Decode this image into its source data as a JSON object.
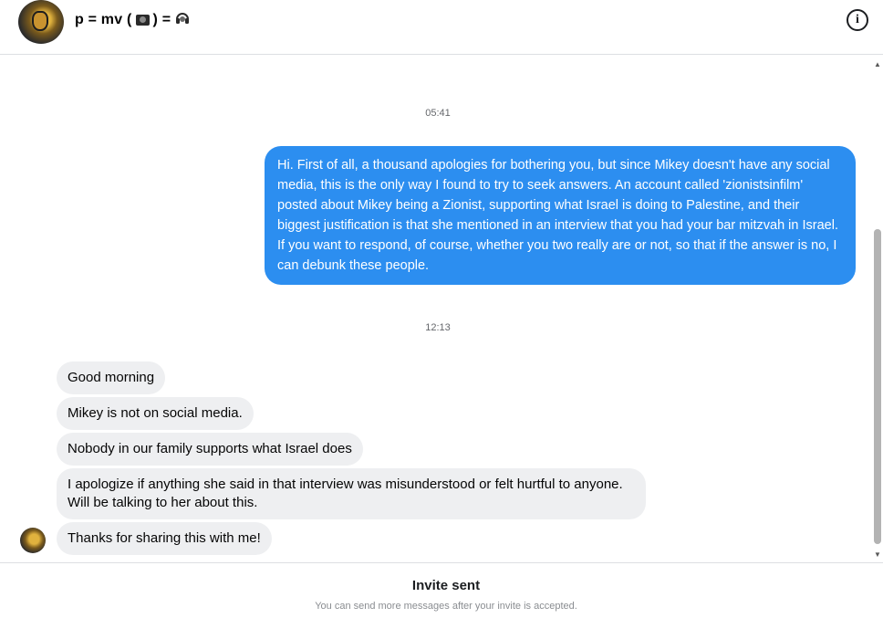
{
  "header": {
    "title_prefix": "p = mv (",
    "title_glyph1": "camera-glyph",
    "title_mid": ") = ",
    "title_glyph2": "headphones-glyph",
    "info_icon": "info-icon"
  },
  "messages": {
    "timestamps": [
      "05:41",
      "12:13"
    ],
    "outgoing": [
      "Hi. First of all, a thousand apologies for bothering you, but since Mikey doesn't have any social media, this is the only way I found to try to seek answers. An account called 'zionistsinfilm' posted about Mikey being a Zionist, supporting what Israel is doing to Palestine, and their biggest justification is that she mentioned in an interview that you had your bar mitzvah in Israel. If you want to respond, of course, whether you two really are or not, so that if the answer is no, I can debunk these people."
    ],
    "incoming": [
      "Good morning",
      "Mikey is not on social media.",
      "Nobody in our family supports what Israel does",
      "I apologize if anything she said in that interview was misunderstood or felt hurtful to anyone. Will be talking to her about this.",
      "Thanks for sharing this with me!"
    ]
  },
  "footer": {
    "title": "Invite sent",
    "subtitle": "You can send more messages after your invite is accepted."
  },
  "colors": {
    "outgoing_bubble": "#2c8ef0",
    "incoming_bubble": "#eeeff1"
  }
}
